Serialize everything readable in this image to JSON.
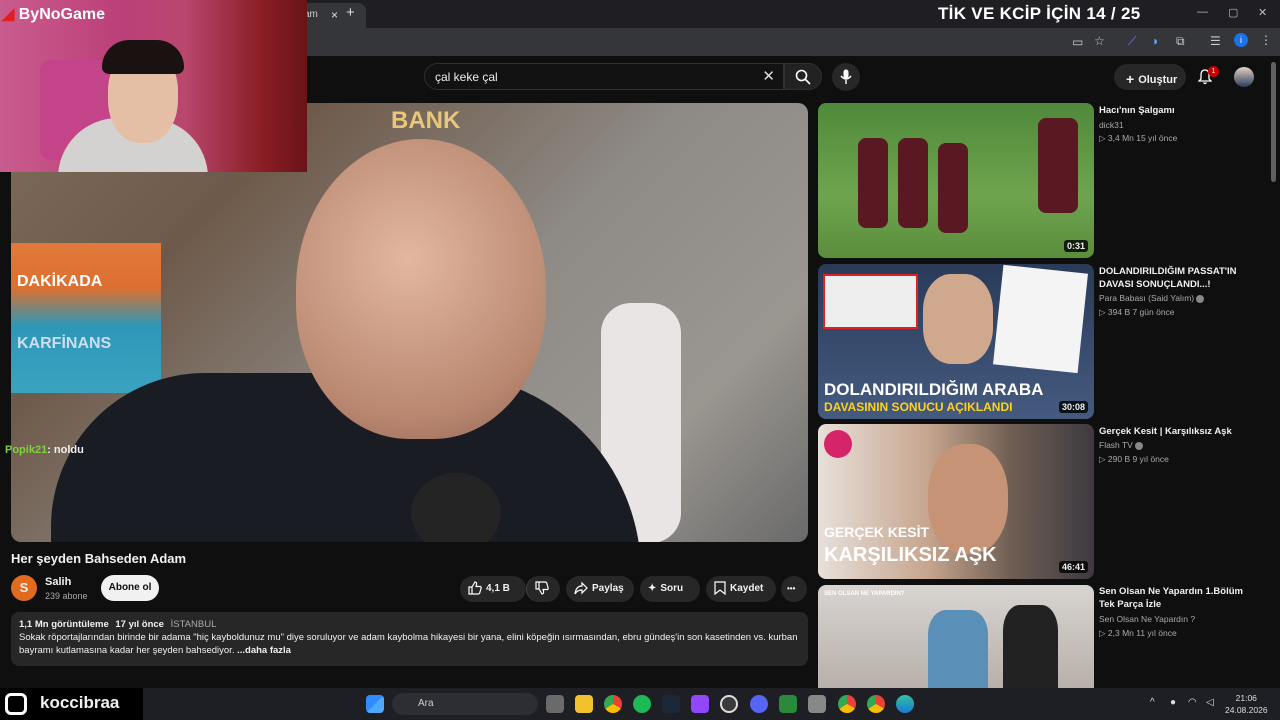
{
  "browser": {
    "tab_fragment": "am",
    "tab_close": "×",
    "new_tab": "+",
    "window_controls": [
      "—",
      "▢",
      "✕"
    ]
  },
  "stream_overlay": {
    "top_text": "TİK VE KCİP İÇİN 14 / 25",
    "logo_text": "ByNoGame",
    "chat_user": "Popik21",
    "chat_message": ": noldu",
    "streamer_name": "koccibraa"
  },
  "search": {
    "query": "çal keke çal"
  },
  "header": {
    "create_label": "Oluştur",
    "notification_count": "1"
  },
  "video": {
    "scene_text_1": "DAKİKADA",
    "scene_text_2": "KARFİNANS",
    "scene_text_3": "BANK",
    "title": "Her şeyden Bahseden Adam",
    "channel_initial": "S",
    "channel_name": "Salih",
    "subscribers": "239 abone",
    "subscribe_label": "Abone ol",
    "likes": "4,1 B",
    "share_label": "Paylaş",
    "ask_label": "Soru",
    "save_label": "Kaydet",
    "more_label": "•••",
    "views": "1,1 Mn görüntüleme",
    "age": "17 yıl önce",
    "location": "İSTANBUL",
    "description": "Sokak röportajlarından birinde bir adama \"hiç kayboldunuz mu\" diye soruluyor ve adam kaybolma hikayesi bir yana, elini köpeğin ısırmasından, ebru gündeş'in son kasetinden vs. kurban bayramı kutlamasına kadar her şeyden bahsediyor.",
    "more_link": "...daha fazla"
  },
  "recommendations": [
    {
      "title": "Hacı'nın Şalgamı",
      "channel": "dick31",
      "meta": "▷ 3,4 Mn   15 yıl önce",
      "duration": "0:31",
      "thumb_text": ""
    },
    {
      "title": "DOLANDIRILDIĞIM PASSAT'IN DAVASI SONUÇLANDI...!",
      "channel": "Para Babası (Said Yalım)",
      "meta": "▷ 394 B   7 gün önce",
      "duration": "30:08",
      "thumb_text": "DOLANDIRILDIĞIM ARABA",
      "thumb_text2": "DAVASININ SONUCU AÇIKLANDI"
    },
    {
      "title": "Gerçek Kesit | Karşılıksız Aşk",
      "channel": "Flash TV",
      "meta": "▷ 290 B   9 yıl önce",
      "duration": "46:41",
      "thumb_text": "GERÇEK KESİT",
      "thumb_text2": "KARŞILIKSIZ AŞK"
    },
    {
      "title": "Sen Olsan Ne Yapardın  1.Bölüm Tek Parça İzle",
      "channel": "Sen Olsan Ne Yapardın ?",
      "meta": "▷ 2,3 Mn   11 yıl önce",
      "duration": "",
      "thumb_text": "SEN OLSAN NE YAPARDIN?"
    }
  ],
  "taskbar": {
    "search_placeholder": "Ara",
    "time": "21:06",
    "date": "24.08.2026"
  },
  "colors": {
    "background": "#0f0f0f",
    "accent_red": "#cc0000",
    "chat_user": "#7dd33b"
  }
}
